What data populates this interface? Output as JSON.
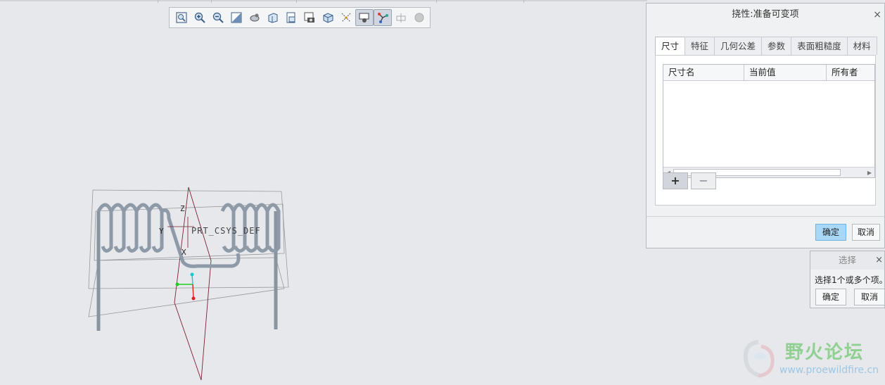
{
  "dialog": {
    "title": "挠性:准备可变项",
    "close": "×",
    "tabs": [
      {
        "label": "尺寸",
        "active": true
      },
      {
        "label": "特征"
      },
      {
        "label": "几何公差"
      },
      {
        "label": "参数"
      },
      {
        "label": "表面粗糙度"
      },
      {
        "label": "材料"
      }
    ],
    "table_headers": [
      "尺寸名",
      "当前值",
      "所有者"
    ],
    "add_label": "+",
    "remove_label": "−",
    "ok": "确定",
    "cancel": "取消"
  },
  "select_popup": {
    "title": "选择",
    "close": "×",
    "message": "选择1个或多个项。",
    "ok": "确定",
    "cancel": "取消"
  },
  "model": {
    "csys_label": "PRT_CSYS_DEF",
    "axis_z": "Z",
    "axis_y": "Y",
    "axis_x": "X"
  },
  "watermark": {
    "title": "野火论坛",
    "url": "www.proewildfire.cn"
  },
  "toolbar": [
    {
      "icon": "zoom-fit-icon"
    },
    {
      "icon": "zoom-in-icon"
    },
    {
      "icon": "zoom-out-icon"
    },
    {
      "icon": "repaint-icon"
    },
    {
      "icon": "spin-center-icon"
    },
    {
      "icon": "view-manager-icon"
    },
    {
      "icon": "saved-views-icon"
    },
    {
      "icon": "snapshot-icon"
    },
    {
      "icon": "perspective-icon"
    },
    {
      "icon": "datum-display-icon"
    },
    {
      "icon": "annotation-display-icon",
      "active": true
    },
    {
      "icon": "spring-display-icon",
      "active": true
    },
    {
      "icon": "section-icon"
    },
    {
      "icon": "appearance-icon"
    }
  ]
}
